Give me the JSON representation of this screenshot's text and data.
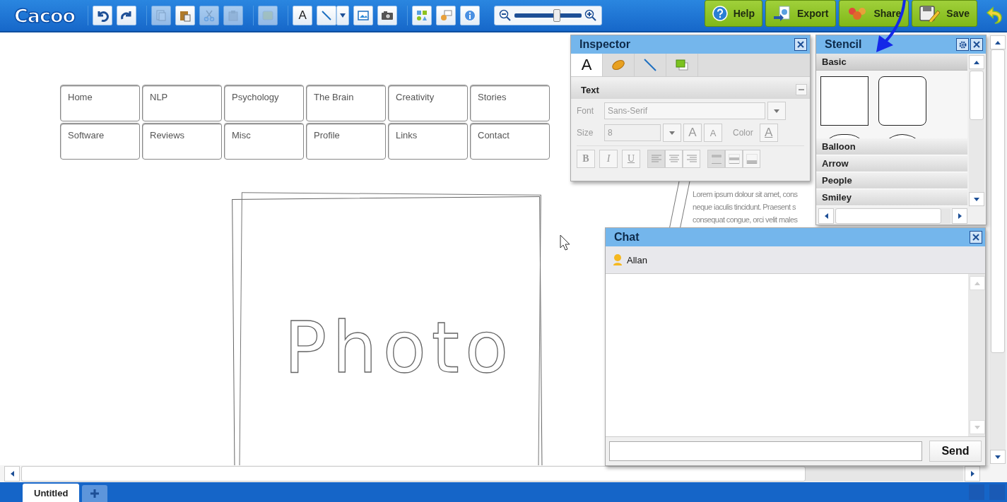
{
  "app": {
    "logo": "Cacoo"
  },
  "toolbar": {
    "groups": [
      [
        {
          "kind": "undo",
          "disabled": false
        },
        {
          "kind": "redo",
          "disabled": false
        }
      ],
      [
        {
          "kind": "copy",
          "disabled": true
        },
        {
          "kind": "paste",
          "disabled": false
        },
        {
          "kind": "cut",
          "disabled": true
        },
        {
          "kind": "clipboard",
          "disabled": true
        }
      ],
      [
        {
          "kind": "note",
          "disabled": true
        }
      ],
      [
        {
          "kind": "text",
          "label": "A",
          "disabled": false
        },
        {
          "kind": "line",
          "disabled": false
        },
        {
          "kind": "dropdown",
          "disabled": false
        },
        {
          "kind": "image",
          "disabled": false
        },
        {
          "kind": "camera",
          "disabled": false
        }
      ],
      [
        {
          "kind": "shapes",
          "disabled": false
        },
        {
          "kind": "comment",
          "disabled": false
        },
        {
          "kind": "info",
          "disabled": false
        }
      ]
    ],
    "zoom": {
      "level": 0.63
    },
    "actions": [
      {
        "kind": "help",
        "label": "Help"
      },
      {
        "kind": "export",
        "label": "Export"
      },
      {
        "kind": "share",
        "label": "Share"
      },
      {
        "kind": "save",
        "label": "Save"
      }
    ]
  },
  "canvas": {
    "nav_items": [
      "Home",
      "NLP",
      "Psychology",
      "The Brain",
      "Creativity",
      "Stories",
      "Software",
      "Reviews",
      "Misc",
      "Profile",
      "Links",
      "Contact"
    ],
    "photo_label": "Photo",
    "lorem_lines": [
      "Lorem ipsum dolour sit amet, cons",
      "neque iaculis tincidunt. Praesent s",
      "consequat congue, orci velit males"
    ]
  },
  "inspector": {
    "title": "Inspector",
    "tabs": [
      {
        "kind": "text",
        "label": "A",
        "selected": true
      },
      {
        "kind": "fill",
        "selected": false
      },
      {
        "kind": "line",
        "selected": false
      },
      {
        "kind": "shadow",
        "selected": false
      }
    ],
    "section": "Text",
    "disabled": true,
    "font_label": "Font",
    "font_value": "Sans-Serif",
    "size_label": "Size",
    "size_value": "8",
    "size_buttons": [
      "A",
      "A"
    ],
    "color_label": "Color",
    "color_button": "A",
    "style_buttons": [
      "B",
      "I",
      "U"
    ]
  },
  "stencil": {
    "title": "Stencil",
    "categories": [
      {
        "label": "Basic",
        "expanded": true
      },
      {
        "label": "Balloon",
        "expanded": false
      },
      {
        "label": "Arrow",
        "expanded": false
      },
      {
        "label": "People",
        "expanded": false
      },
      {
        "label": "Smiley",
        "expanded": false
      }
    ]
  },
  "chat": {
    "title": "Chat",
    "users": [
      "Allan"
    ],
    "send": "Send"
  },
  "pages": [
    {
      "label": "Untitled",
      "selected": true
    }
  ]
}
